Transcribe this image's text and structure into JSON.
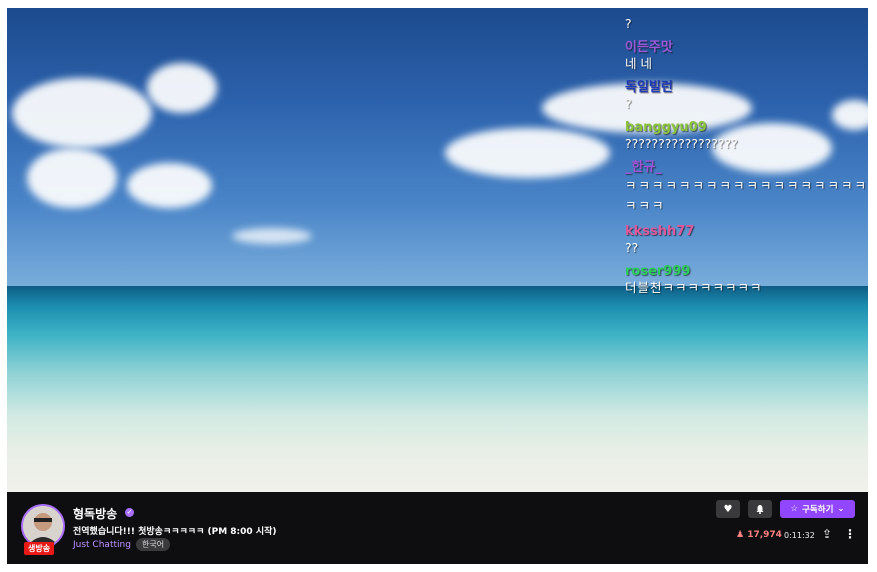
{
  "chat": {
    "messages": [
      {
        "nick": "",
        "text": "?",
        "color": ""
      },
      {
        "nick": "이든주맛",
        "text": "네 네",
        "color": "#9b59d6"
      },
      {
        "nick": "독일빌런",
        "text": "?",
        "color": "#1e3ab8"
      },
      {
        "nick": "banggyu09",
        "text": "?????????????????",
        "color": "#8ac43a"
      },
      {
        "nick": "_한규_",
        "text": "ㅋㅋㅋㅋㅋㅋㅋㅋㅋㅋㅋㅋㅋㅋㅋㅋㅋㅋㅋㅋㅋ",
        "color": "#a155d6"
      },
      {
        "nick": "kksshh77",
        "text": "??",
        "color": "#e0589a"
      },
      {
        "nick": "roser999",
        "text": "더블천ㅋㅋㅋㅋㅋㅋㅋㅋ",
        "color": "#2ecc59"
      }
    ]
  },
  "stream": {
    "streamer_name": "형독방송",
    "live_badge": "생방송",
    "title": "전역했습니다!!! 첫방송ㅋㅋㅋㅋㅋ (PM 8:00 시작)",
    "category": "Just Chatting",
    "language_tag": "한국어",
    "viewer_count": "17,974",
    "uptime": "0:11:32"
  },
  "actions": {
    "subscribe_label": "구독하기",
    "heart_icon": "heart-icon",
    "bell_icon": "bell-icon",
    "share_icon": "share-icon",
    "more_icon": "more-vertical-icon"
  },
  "colors": {
    "accent": "#9147ff",
    "live_red": "#e91916",
    "viewer_red": "#ff8280",
    "bar_bg": "#0e0e10"
  }
}
